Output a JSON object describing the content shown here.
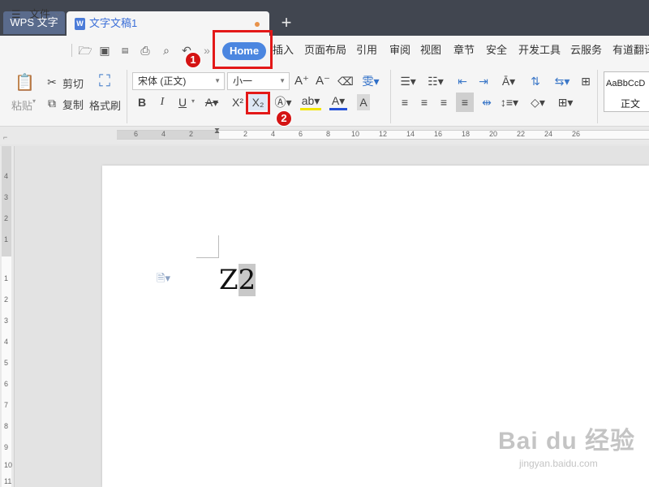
{
  "tabs": {
    "app": "WPS 文字",
    "document": "文字文稿1",
    "add": "+"
  },
  "menu": {
    "file": "文件",
    "items": [
      "Home",
      "插入",
      "页面布局",
      "引用",
      "审阅",
      "视图",
      "章节",
      "安全",
      "开发工具",
      "云服务",
      "有道翻译"
    ]
  },
  "ribbon": {
    "paste": "粘贴",
    "cut": "剪切",
    "copy": "复制",
    "format_painter": "格式刷",
    "font_name": "宋体 (正文)",
    "font_size": "小一",
    "bold": "B",
    "italic": "I",
    "underline": "U",
    "superscript": "X²",
    "subscript": "X₂",
    "style_preview": "AaBbCcD",
    "style_name": "正文"
  },
  "annotations": {
    "badge1": "1",
    "badge2": "2"
  },
  "document": {
    "text_main": "Z",
    "text_selected": "2"
  },
  "ruler": {
    "h_numbers": [
      "6",
      "4",
      "2",
      "2",
      "4",
      "6",
      "8",
      "10",
      "12",
      "14",
      "16",
      "18",
      "20",
      "22",
      "24",
      "26"
    ],
    "v_numbers": [
      "4",
      "3",
      "2",
      "1",
      "1",
      "2",
      "3",
      "4",
      "5",
      "6",
      "7",
      "8",
      "9",
      "10",
      "11"
    ]
  },
  "watermark": {
    "main": "Bai du 经验",
    "sub": "jingyan.baidu.com"
  },
  "colors": {
    "accent": "#4b86e0",
    "highlight_box": "#e31818",
    "tabbar": "#414650"
  }
}
